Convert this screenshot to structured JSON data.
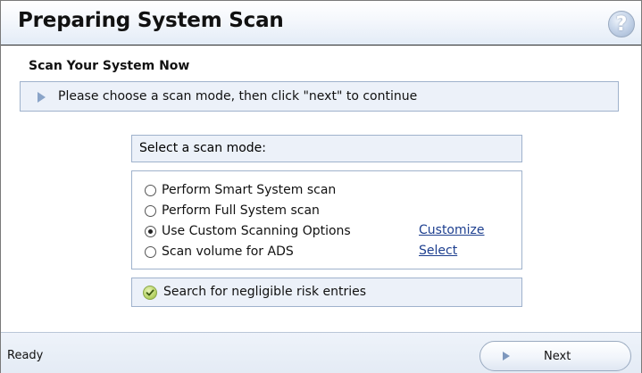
{
  "window": {
    "title": "Preparing System Scan",
    "help_glyph": "?"
  },
  "section": {
    "title": "Scan Your System Now",
    "instruction": "Please choose a scan mode, then click \"next\" to continue"
  },
  "scan_mode": {
    "header": "Select a scan mode:",
    "options": [
      {
        "label": "Perform Smart System scan",
        "selected": false,
        "link": ""
      },
      {
        "label": "Perform Full System scan",
        "selected": false,
        "link": ""
      },
      {
        "label": "Use Custom Scanning Options",
        "selected": true,
        "link": "Customize"
      },
      {
        "label": "Scan volume for ADS",
        "selected": false,
        "link": "Select"
      }
    ]
  },
  "risk": {
    "label": "Search for negligible risk entries",
    "checked": true
  },
  "status": {
    "text": "Ready"
  },
  "footer": {
    "next_label": "Next"
  },
  "colors": {
    "panel_fill": "#ecf1f9",
    "panel_border": "#9fb2cc",
    "link": "#1d3f8f",
    "arrow": "#8aa4c8"
  }
}
